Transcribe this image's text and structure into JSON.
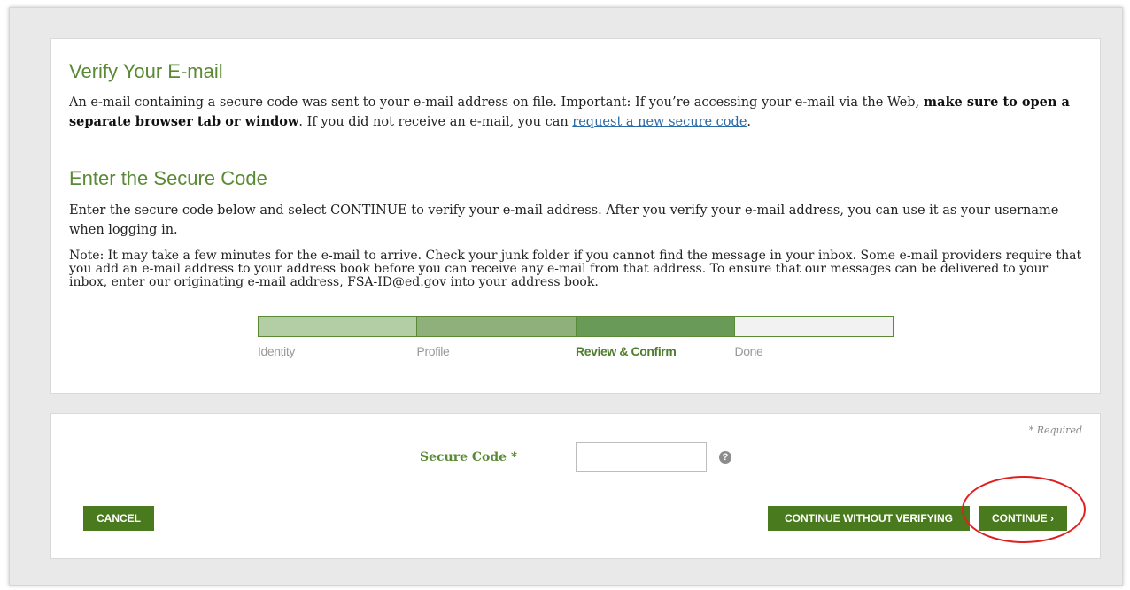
{
  "verify": {
    "title": "Verify Your E-mail",
    "text1": "An e-mail containing a secure code was sent to your e-mail address on file. Important: If you’re accessing your e-mail via the Web,",
    "bold": "make sure to open a separate browser tab or window",
    "text2": ". If you did not receive an e-mail, you can",
    "link": "request a new secure code",
    "text3": "."
  },
  "enter": {
    "title": "Enter the Secure Code",
    "text": "Enter the secure code below and select CONTINUE to verify your e-mail address. After you verify your e-mail address, you can use it as your username when logging in.",
    "note": "Note: It may take a few minutes for the e-mail to arrive. Check your junk folder if you cannot find the message in your inbox. Some e-mail providers require that you add an e-mail address to your address book before you can receive any e-mail from that address. To ensure that our messages can be delivered to your inbox, enter our originating e-mail address, FSA-ID@ed.gov into your address book."
  },
  "progress": {
    "steps": [
      "Identity",
      "Profile",
      "Review & Confirm",
      "Done"
    ],
    "active_index": 2,
    "colors": [
      "#b3cda4",
      "#8fb07a",
      "#6a9a58",
      "#f2f2f2"
    ]
  },
  "form": {
    "required_note": "* Required",
    "secure_code_label": "Secure Code *",
    "secure_code_value": "",
    "help_glyph": "?"
  },
  "buttons": {
    "cancel": "CANCEL",
    "continue_without": "CONTINUE WITHOUT VERIFYING",
    "continue": "CONTINUE ›"
  },
  "accent_color": "#5a8a35",
  "highlight_color": "#e02020"
}
